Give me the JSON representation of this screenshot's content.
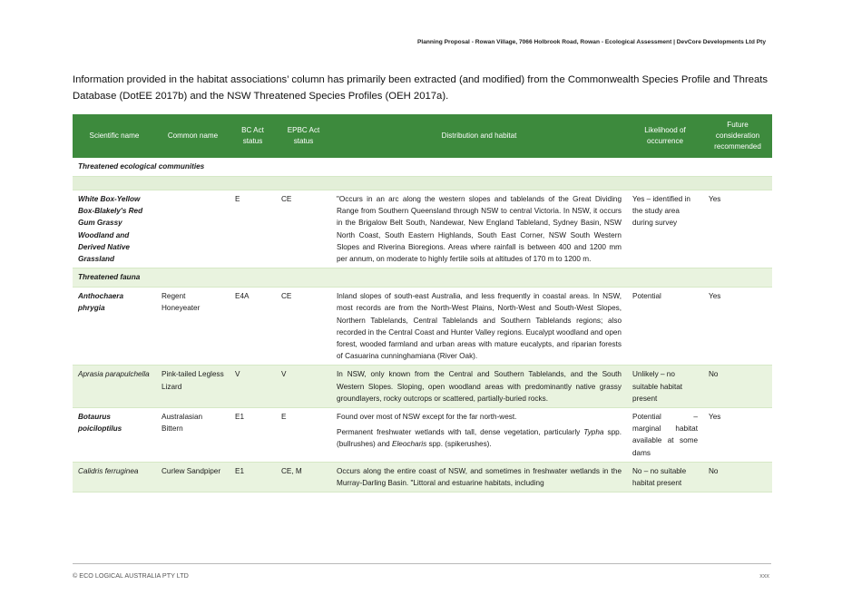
{
  "header": {
    "title": "Planning Proposal -  Rowan Village, 7066 Holbrook Road, Rowan - Ecological Assessment | DevCore Developments Ltd Pty"
  },
  "intro": {
    "text": "Information provided in the habitat associations’ column has primarily been extracted (and modified) from the Commonwealth Species Profile and Threats Database (DotEE 2017b) and the NSW Threatened Species Profiles (OEH 2017a)."
  },
  "table": {
    "columns": [
      "Scientific name",
      "Common name",
      "BC Act status",
      "EPBC Act status",
      "Distribution and habitat",
      "Likelihood of occurrence",
      "Future consideration recommended"
    ],
    "section_communities": "Threatened ecological communities",
    "section_fauna": "Threatened fauna",
    "community_row": {
      "scientific": "White Box-Yellow Box-Blakely's Red Gum Grassy Woodland and Derived Native Grassland",
      "common": "",
      "bc": "E",
      "epbc": "CE",
      "habitat": "\"Occurs in an arc along the western slopes and tablelands of the Great Dividing Range from Southern Queensland through NSW to central Victoria. In NSW, it occurs in the Brigalow Belt South, Nandewar, New England Tableland, Sydney Basin, NSW North Coast, South Eastern Highlands, South East Corner, NSW South Western Slopes and Riverina Bioregions. Areas where rainfall is between 400 and 1200 mm per annum, on moderate to highly fertile soils at altitudes of 170 m to 1200 m.",
      "likelihood": "Yes – identified in the study area during survey",
      "future": "Yes"
    },
    "fauna_rows": [
      {
        "scientific": "Anthochaera phrygia",
        "common": "Regent Honeyeater",
        "bc": "E4A",
        "epbc": "CE",
        "habitat": "Inland slopes of south-east Australia, and less frequently in coastal areas. In NSW, most records are from the North-West Plains, North-West and South-West Slopes, Northern Tablelands, Central Tablelands and Southern Tablelands regions; also recorded in the Central Coast and Hunter Valley regions. Eucalypt woodland and open forest, wooded farmland and urban areas with mature eucalypts, and riparian forests of Casuarina cunninghamiana (River Oak).",
        "likelihood": "Potential",
        "future": "Yes"
      },
      {
        "scientific": "Aprasia parapulchella",
        "common": "Pink-tailed Legless Lizard",
        "bc": "V",
        "epbc": "V",
        "habitat": "In NSW, only known from the Central and Southern Tablelands, and the South Western Slopes. Sloping, open woodland areas with predominantly native grassy groundlayers, rocky outcrops or scattered, partially-buried rocks.",
        "likelihood": "Unlikely – no suitable habitat present",
        "future": "No"
      },
      {
        "scientific": "Botaurus poiciloptilus",
        "common": "Australasian Bittern",
        "bc": "E1",
        "epbc": "E",
        "habitat": "Found over most of NSW except for the far north-west.",
        "habitat_2a": "Permanent freshwater wetlands with tall, dense vegetation, particularly ",
        "habitat_2b": "Typha",
        "habitat_2c": " spp. (bullrushes) and ",
        "habitat_2d": "Eleocharis",
        "habitat_2e": " spp. (spikerushes).",
        "likelihood": "Potential – marginal habitat available at some dams",
        "future": "Yes"
      },
      {
        "scientific": "Calidris ferruginea",
        "common": "Curlew Sandpiper",
        "bc": "E1",
        "epbc": "CE, M",
        "habitat": "Occurs along the entire coast of NSW, and sometimes in freshwater wetlands in the Murray-Darling Basin. \"Littoral and estuarine habitats, including",
        "likelihood": "No – no suitable habitat present",
        "future": "No"
      }
    ]
  },
  "footer": {
    "left": "© ECO LOGICAL AUSTRALIA PTY LTD",
    "right": "xxx"
  }
}
